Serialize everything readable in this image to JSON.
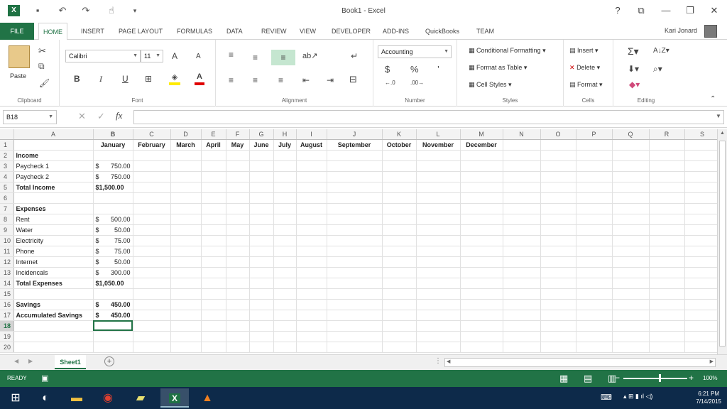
{
  "window": {
    "title": "Book1 - Excel",
    "help": "?",
    "minimize": "—",
    "restore": "❐",
    "close": "✕"
  },
  "qat": {
    "logo": "X"
  },
  "tabs": [
    "FILE",
    "HOME",
    "INSERT",
    "PAGE LAYOUT",
    "FORMULAS",
    "DATA",
    "REVIEW",
    "VIEW",
    "DEVELOPER",
    "ADD-INS",
    "QuickBooks",
    "TEAM"
  ],
  "user": {
    "name": "Kari Jonard"
  },
  "ribbon": {
    "clipboard": {
      "label": "Clipboard",
      "paste": "Paste"
    },
    "font": {
      "label": "Font",
      "name": "Calibri",
      "size": "11",
      "bold": "B",
      "italic": "I",
      "underline": "U"
    },
    "alignment": {
      "label": "Alignment"
    },
    "number": {
      "label": "Number",
      "format": "Accounting",
      "currency": "$",
      "percent": "%",
      "comma": "’"
    },
    "styles": {
      "label": "Styles",
      "conditional": "Conditional Formatting",
      "format_table": "Format as Table",
      "cell_styles": "Cell Styles"
    },
    "cells": {
      "label": "Cells",
      "insert": "Insert",
      "delete": "Delete",
      "format": "Format"
    },
    "editing": {
      "label": "Editing"
    }
  },
  "formula_bar": {
    "name_box": "B18",
    "fx": "fx",
    "value": ""
  },
  "grid": {
    "columns": [
      "A",
      "B",
      "C",
      "D",
      "E",
      "F",
      "G",
      "H",
      "I",
      "J",
      "K",
      "L",
      "M",
      "N",
      "O",
      "P",
      "Q",
      "R",
      "S"
    ],
    "rows": [
      {
        "n": "1",
        "a": "",
        "b": "January",
        "rest": [
          "February",
          "March",
          "April",
          "May",
          "June",
          "July",
          "August",
          "September",
          "October",
          "November",
          "December"
        ]
      },
      {
        "n": "2",
        "a": "Income",
        "b": ""
      },
      {
        "n": "3",
        "a": "Paycheck 1",
        "cur": "$",
        "amt": "750.00"
      },
      {
        "n": "4",
        "a": "Paycheck 2",
        "cur": "$",
        "amt": "750.00"
      },
      {
        "n": "5",
        "a": "Total Income",
        "b": "$1,500.00"
      },
      {
        "n": "6",
        "a": "",
        "b": ""
      },
      {
        "n": "7",
        "a": "Expenses",
        "b": ""
      },
      {
        "n": "8",
        "a": "Rent",
        "cur": "$",
        "amt": "500.00"
      },
      {
        "n": "9",
        "a": "Water",
        "cur": "$",
        "amt": "50.00"
      },
      {
        "n": "10",
        "a": "Electricity",
        "cur": "$",
        "amt": "75.00"
      },
      {
        "n": "11",
        "a": "Phone",
        "cur": "$",
        "amt": "75.00"
      },
      {
        "n": "12",
        "a": "Internet",
        "cur": "$",
        "amt": "50.00"
      },
      {
        "n": "13",
        "a": "Incidencals",
        "cur": "$",
        "amt": "300.00"
      },
      {
        "n": "14",
        "a": "Total Expenses",
        "b": "$1,050.00"
      },
      {
        "n": "15",
        "a": "",
        "b": ""
      },
      {
        "n": "16",
        "a": "Savings",
        "cur": "$",
        "amt": "450.00"
      },
      {
        "n": "17",
        "a": "Accumulated Savings",
        "cur": "$",
        "amt": "450.00"
      },
      {
        "n": "18",
        "a": "",
        "b": ""
      },
      {
        "n": "19",
        "a": "",
        "b": ""
      },
      {
        "n": "20",
        "a": "",
        "b": ""
      }
    ]
  },
  "sheets": {
    "active": "Sheet1",
    "add": "+"
  },
  "status": {
    "ready": "READY",
    "zoom": "100%"
  },
  "taskbar": {
    "time": "6:21 PM",
    "date": "7/14/2015"
  }
}
